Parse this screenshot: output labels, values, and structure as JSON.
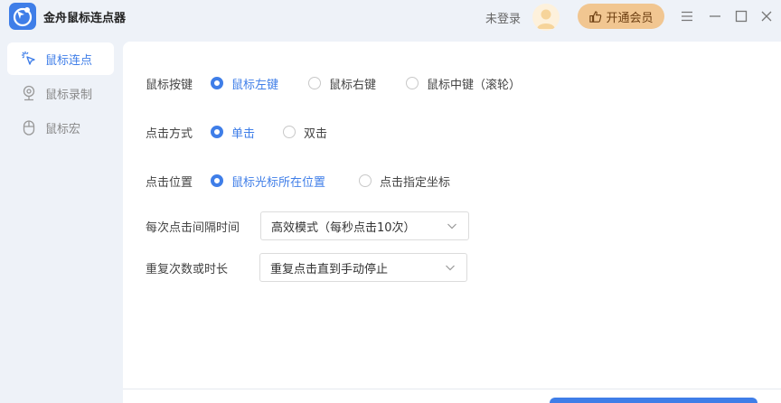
{
  "app": {
    "title": "金舟鼠标连点器"
  },
  "header": {
    "login_text": "未登录",
    "vip_label": "开通会员"
  },
  "sidebar": {
    "items": [
      {
        "label": "鼠标连点",
        "icon": "cursor-click-icon",
        "active": true
      },
      {
        "label": "鼠标录制",
        "icon": "webcam-record-icon",
        "active": false
      },
      {
        "label": "鼠标宏",
        "icon": "mouse-icon",
        "active": false
      }
    ]
  },
  "form": {
    "mouse_button": {
      "label": "鼠标按键",
      "options": [
        "鼠标左键",
        "鼠标右键",
        "鼠标中键（滚轮）"
      ],
      "selected": "鼠标左键"
    },
    "click_mode": {
      "label": "点击方式",
      "options": [
        "单击",
        "双击"
      ],
      "selected": "单击"
    },
    "click_position": {
      "label": "点击位置",
      "options": [
        "鼠标光标所在位置",
        "点击指定坐标"
      ],
      "selected": "鼠标光标所在位置"
    },
    "interval": {
      "label": "每次点击间隔时间",
      "value": "高效模式（每秒点击10次）"
    },
    "repeat": {
      "label": "重复次数或时长",
      "value": "重复点击直到手动停止"
    }
  },
  "colors": {
    "accent": "#3f7ee8",
    "vip_bg": "#f1c691",
    "background": "#eef2f8"
  }
}
